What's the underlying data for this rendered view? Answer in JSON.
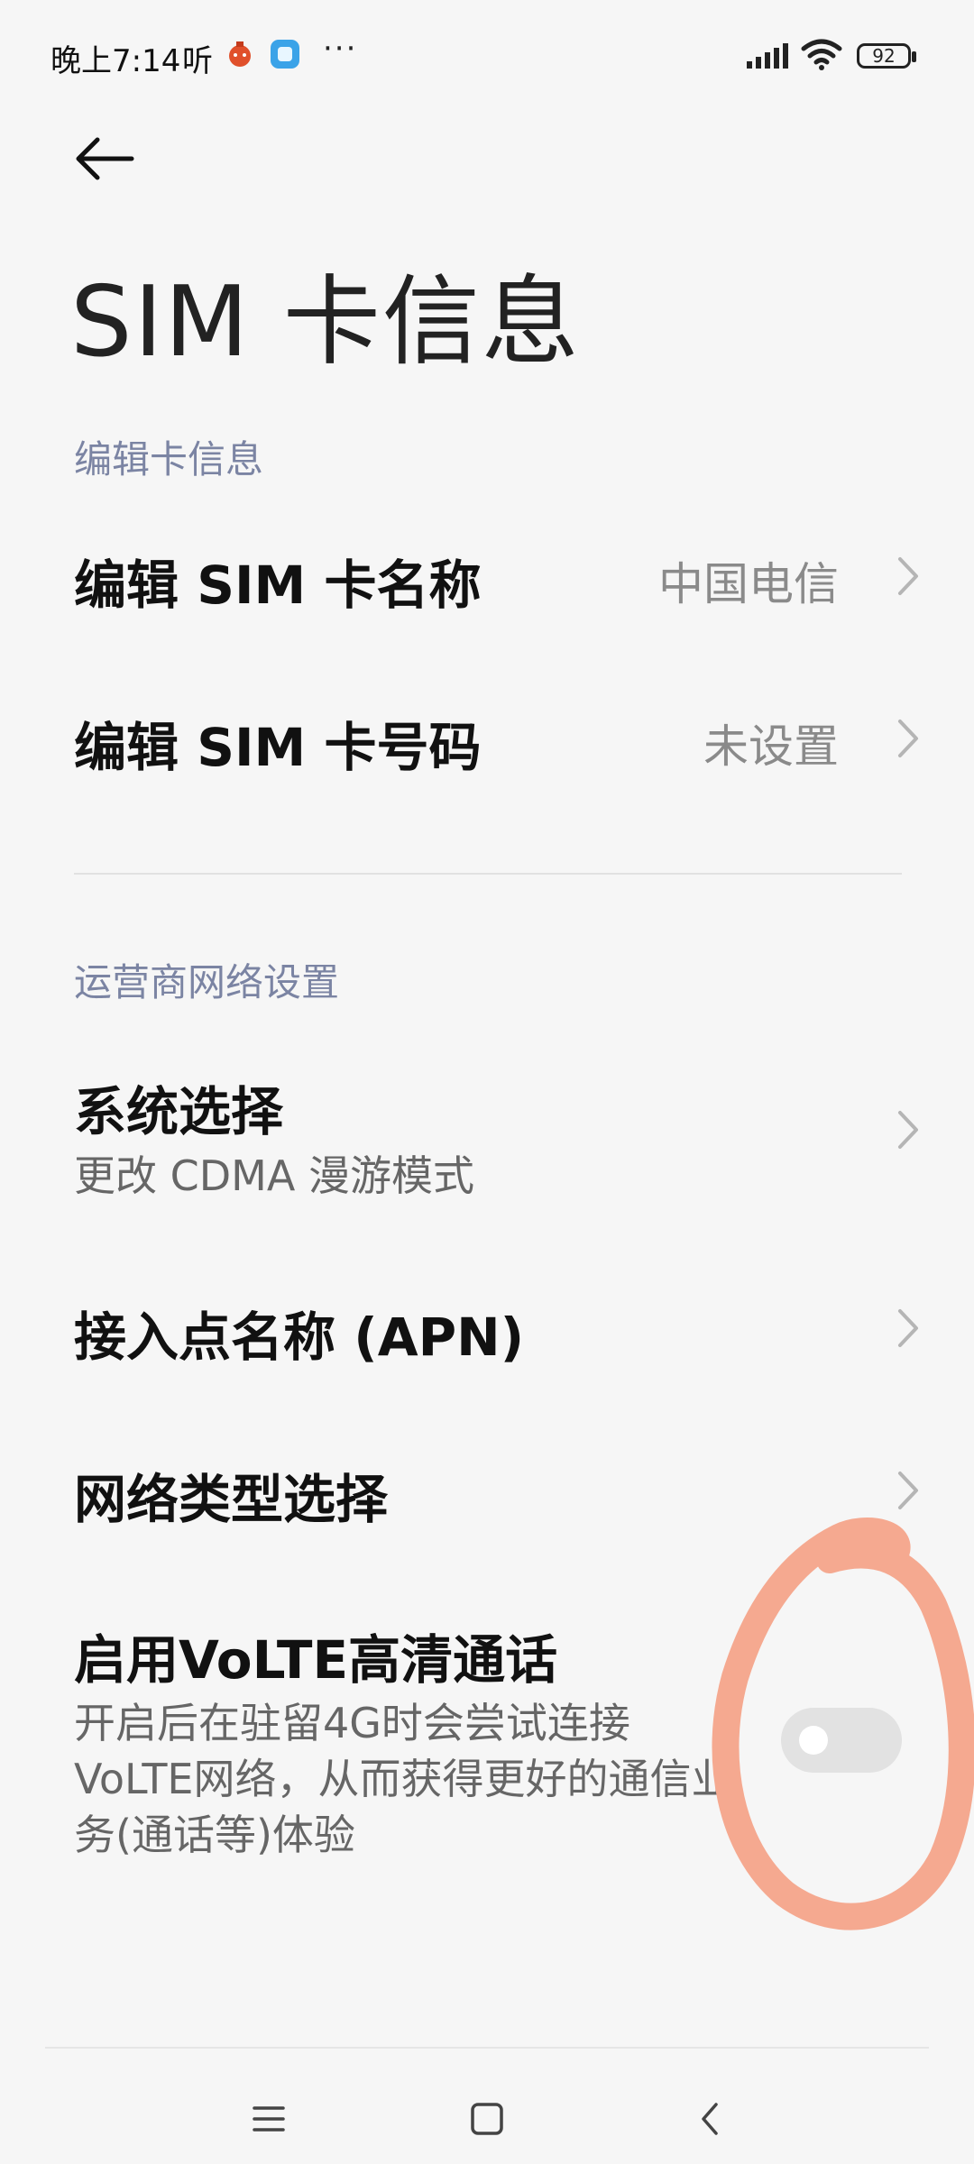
{
  "status_bar": {
    "time": "晚上7:14",
    "speed_icon": "听",
    "more": "···",
    "battery": "92",
    "icons": [
      "bomb-app-icon",
      "app-square-icon",
      "signal-icon",
      "wifi-icon",
      "battery-icon"
    ]
  },
  "header": {
    "title": "SIM 卡信息"
  },
  "sections": {
    "edit_card": {
      "header": "编辑卡信息",
      "sim_name": {
        "label": "编辑 SIM 卡名称",
        "value": "中国电信"
      },
      "sim_number": {
        "label": "编辑 SIM 卡号码",
        "value": "未设置"
      }
    },
    "network": {
      "header": "运营商网络设置",
      "system_select": {
        "label": "系统选择",
        "subtitle": "更改 CDMA 漫游模式"
      },
      "apn": {
        "label": "接入点名称 (APN)"
      },
      "network_type": {
        "label": "网络类型选择"
      },
      "volte": {
        "label": "启用VoLTE高清通话",
        "description": "开启后在驻留4G时会尝试连接VoLTE网络，从而获得更好的通信业务(通话等)体验",
        "enabled": false
      }
    }
  },
  "colors": {
    "background": "#f6f6f6",
    "section_header": "#7b84a3",
    "annotation": "#f5a990"
  }
}
